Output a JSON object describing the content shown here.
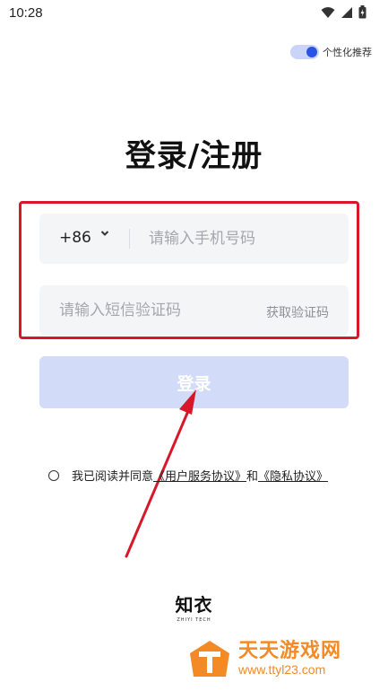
{
  "status_bar": {
    "time": "10:28",
    "icons": [
      "wifi-icon",
      "signal-icon",
      "battery-icon"
    ]
  },
  "recommend_toggle": {
    "label": "个性化推荐",
    "on": true
  },
  "page_title": "登录/注册",
  "phone_row": {
    "country_code": "+86",
    "placeholder": "请输入手机号码"
  },
  "code_row": {
    "placeholder": "请输入短信验证码",
    "get_code_label": "获取验证码"
  },
  "login_button": {
    "label": "登录"
  },
  "agreement": {
    "prefix": "我已阅读并同意",
    "user_agreement": "《用户服务协议》",
    "and": "和",
    "privacy": "《隐私协议》"
  },
  "logo": {
    "name": "知衣",
    "sub": "ZHIYI TECH"
  },
  "watermark": {
    "cn": "天天游戏网",
    "url": "www.ttyl23.com"
  },
  "colors": {
    "accent": "#2a53e6",
    "button_disabled": "#d2dbf7",
    "annotation_red": "#d8182a",
    "watermark_orange": "#f38a26"
  }
}
